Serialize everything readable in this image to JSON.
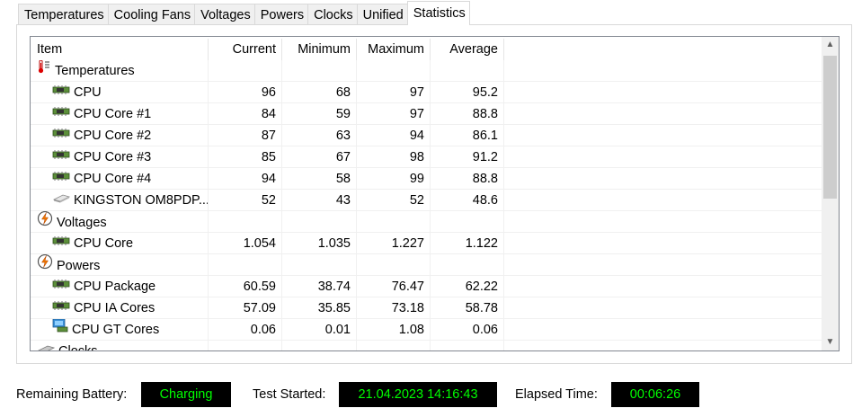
{
  "tabs": [
    "Temperatures",
    "Cooling Fans",
    "Voltages",
    "Powers",
    "Clocks",
    "Unified",
    "Statistics"
  ],
  "active_tab": "Statistics",
  "grid": {
    "headers": {
      "item": "Item",
      "current": "Current",
      "minimum": "Minimum",
      "maximum": "Maximum",
      "average": "Average"
    },
    "rows": [
      {
        "type": "group",
        "icon": "thermometer-icon",
        "item": "Temperatures"
      },
      {
        "type": "data",
        "icon": "cpu-chip-icon",
        "item": "CPU",
        "current": "96",
        "minimum": "68",
        "maximum": "97",
        "average": "95.2"
      },
      {
        "type": "data",
        "icon": "cpu-chip-icon",
        "item": "CPU Core #1",
        "current": "84",
        "minimum": "59",
        "maximum": "97",
        "average": "88.8"
      },
      {
        "type": "data",
        "icon": "cpu-chip-icon",
        "item": "CPU Core #2",
        "current": "87",
        "minimum": "63",
        "maximum": "94",
        "average": "86.1"
      },
      {
        "type": "data",
        "icon": "cpu-chip-icon",
        "item": "CPU Core #3",
        "current": "85",
        "minimum": "67",
        "maximum": "98",
        "average": "91.2"
      },
      {
        "type": "data",
        "icon": "cpu-chip-icon",
        "item": "CPU Core #4",
        "current": "94",
        "minimum": "58",
        "maximum": "99",
        "average": "88.8"
      },
      {
        "type": "data",
        "icon": "drive-icon",
        "item": "KINGSTON OM8PDP...",
        "current": "52",
        "minimum": "43",
        "maximum": "52",
        "average": "48.6"
      },
      {
        "type": "group",
        "icon": "voltage-icon",
        "item": "Voltages"
      },
      {
        "type": "data",
        "icon": "cpu-chip-icon",
        "item": "CPU Core",
        "current": "1.054",
        "minimum": "1.035",
        "maximum": "1.227",
        "average": "1.122"
      },
      {
        "type": "group",
        "icon": "power-icon",
        "item": "Powers"
      },
      {
        "type": "data",
        "icon": "cpu-chip-icon",
        "item": "CPU Package",
        "current": "60.59",
        "minimum": "38.74",
        "maximum": "76.47",
        "average": "62.22"
      },
      {
        "type": "data",
        "icon": "cpu-chip-icon",
        "item": "CPU IA Cores",
        "current": "57.09",
        "minimum": "35.85",
        "maximum": "73.18",
        "average": "58.78"
      },
      {
        "type": "data",
        "icon": "gpu-icon",
        "item": "CPU GT Cores",
        "current": "0.06",
        "minimum": "0.01",
        "maximum": "1.08",
        "average": "0.06"
      },
      {
        "type": "group",
        "icon": "clock-icon",
        "item": "Clocks"
      }
    ]
  },
  "status": {
    "battery_label": "Remaining Battery:",
    "battery_value": "Charging",
    "started_label": "Test Started:",
    "started_value": "21.04.2023 14:16:43",
    "elapsed_label": "Elapsed Time:",
    "elapsed_value": "00:06:26"
  },
  "colors": {
    "status_bg": "#000000",
    "status_text": "#00ff00",
    "grid_border": "#828790"
  }
}
